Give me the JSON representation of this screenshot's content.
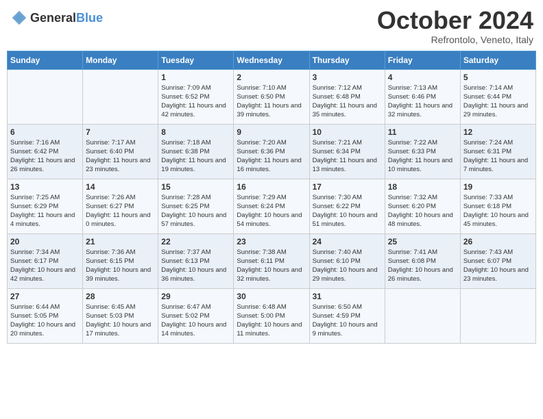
{
  "logo": {
    "general": "General",
    "blue": "Blue"
  },
  "title": "October 2024",
  "subtitle": "Refrontolo, Veneto, Italy",
  "days_of_week": [
    "Sunday",
    "Monday",
    "Tuesday",
    "Wednesday",
    "Thursday",
    "Friday",
    "Saturday"
  ],
  "weeks": [
    [
      {
        "day": "",
        "detail": ""
      },
      {
        "day": "",
        "detail": ""
      },
      {
        "day": "1",
        "detail": "Sunrise: 7:09 AM\nSunset: 6:52 PM\nDaylight: 11 hours and 42 minutes."
      },
      {
        "day": "2",
        "detail": "Sunrise: 7:10 AM\nSunset: 6:50 PM\nDaylight: 11 hours and 39 minutes."
      },
      {
        "day": "3",
        "detail": "Sunrise: 7:12 AM\nSunset: 6:48 PM\nDaylight: 11 hours and 35 minutes."
      },
      {
        "day": "4",
        "detail": "Sunrise: 7:13 AM\nSunset: 6:46 PM\nDaylight: 11 hours and 32 minutes."
      },
      {
        "day": "5",
        "detail": "Sunrise: 7:14 AM\nSunset: 6:44 PM\nDaylight: 11 hours and 29 minutes."
      }
    ],
    [
      {
        "day": "6",
        "detail": "Sunrise: 7:16 AM\nSunset: 6:42 PM\nDaylight: 11 hours and 26 minutes."
      },
      {
        "day": "7",
        "detail": "Sunrise: 7:17 AM\nSunset: 6:40 PM\nDaylight: 11 hours and 23 minutes."
      },
      {
        "day": "8",
        "detail": "Sunrise: 7:18 AM\nSunset: 6:38 PM\nDaylight: 11 hours and 19 minutes."
      },
      {
        "day": "9",
        "detail": "Sunrise: 7:20 AM\nSunset: 6:36 PM\nDaylight: 11 hours and 16 minutes."
      },
      {
        "day": "10",
        "detail": "Sunrise: 7:21 AM\nSunset: 6:34 PM\nDaylight: 11 hours and 13 minutes."
      },
      {
        "day": "11",
        "detail": "Sunrise: 7:22 AM\nSunset: 6:33 PM\nDaylight: 11 hours and 10 minutes."
      },
      {
        "day": "12",
        "detail": "Sunrise: 7:24 AM\nSunset: 6:31 PM\nDaylight: 11 hours and 7 minutes."
      }
    ],
    [
      {
        "day": "13",
        "detail": "Sunrise: 7:25 AM\nSunset: 6:29 PM\nDaylight: 11 hours and 4 minutes."
      },
      {
        "day": "14",
        "detail": "Sunrise: 7:26 AM\nSunset: 6:27 PM\nDaylight: 11 hours and 0 minutes."
      },
      {
        "day": "15",
        "detail": "Sunrise: 7:28 AM\nSunset: 6:25 PM\nDaylight: 10 hours and 57 minutes."
      },
      {
        "day": "16",
        "detail": "Sunrise: 7:29 AM\nSunset: 6:24 PM\nDaylight: 10 hours and 54 minutes."
      },
      {
        "day": "17",
        "detail": "Sunrise: 7:30 AM\nSunset: 6:22 PM\nDaylight: 10 hours and 51 minutes."
      },
      {
        "day": "18",
        "detail": "Sunrise: 7:32 AM\nSunset: 6:20 PM\nDaylight: 10 hours and 48 minutes."
      },
      {
        "day": "19",
        "detail": "Sunrise: 7:33 AM\nSunset: 6:18 PM\nDaylight: 10 hours and 45 minutes."
      }
    ],
    [
      {
        "day": "20",
        "detail": "Sunrise: 7:34 AM\nSunset: 6:17 PM\nDaylight: 10 hours and 42 minutes."
      },
      {
        "day": "21",
        "detail": "Sunrise: 7:36 AM\nSunset: 6:15 PM\nDaylight: 10 hours and 39 minutes."
      },
      {
        "day": "22",
        "detail": "Sunrise: 7:37 AM\nSunset: 6:13 PM\nDaylight: 10 hours and 36 minutes."
      },
      {
        "day": "23",
        "detail": "Sunrise: 7:38 AM\nSunset: 6:11 PM\nDaylight: 10 hours and 32 minutes."
      },
      {
        "day": "24",
        "detail": "Sunrise: 7:40 AM\nSunset: 6:10 PM\nDaylight: 10 hours and 29 minutes."
      },
      {
        "day": "25",
        "detail": "Sunrise: 7:41 AM\nSunset: 6:08 PM\nDaylight: 10 hours and 26 minutes."
      },
      {
        "day": "26",
        "detail": "Sunrise: 7:43 AM\nSunset: 6:07 PM\nDaylight: 10 hours and 23 minutes."
      }
    ],
    [
      {
        "day": "27",
        "detail": "Sunrise: 6:44 AM\nSunset: 5:05 PM\nDaylight: 10 hours and 20 minutes."
      },
      {
        "day": "28",
        "detail": "Sunrise: 6:45 AM\nSunset: 5:03 PM\nDaylight: 10 hours and 17 minutes."
      },
      {
        "day": "29",
        "detail": "Sunrise: 6:47 AM\nSunset: 5:02 PM\nDaylight: 10 hours and 14 minutes."
      },
      {
        "day": "30",
        "detail": "Sunrise: 6:48 AM\nSunset: 5:00 PM\nDaylight: 10 hours and 11 minutes."
      },
      {
        "day": "31",
        "detail": "Sunrise: 6:50 AM\nSunset: 4:59 PM\nDaylight: 10 hours and 9 minutes."
      },
      {
        "day": "",
        "detail": ""
      },
      {
        "day": "",
        "detail": ""
      }
    ]
  ]
}
